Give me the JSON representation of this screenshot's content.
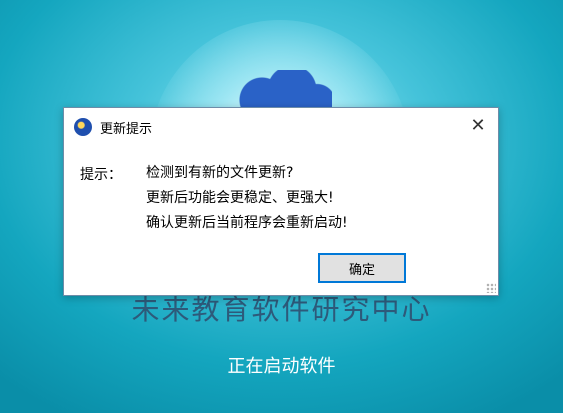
{
  "splash": {
    "title": "未来教育软件研究中心",
    "status": "正在启动软件"
  },
  "dialog": {
    "title": "更新提示",
    "label": "提示：",
    "lines": [
      "检测到有新的文件更新?",
      "更新后功能会更稳定、更强大!",
      "确认更新后当前程序会重新启动!"
    ],
    "ok_label": "确定",
    "close_glyph": "✕"
  },
  "colors": {
    "button_focus_border": "#0078d7",
    "background": "#14a6bf"
  }
}
